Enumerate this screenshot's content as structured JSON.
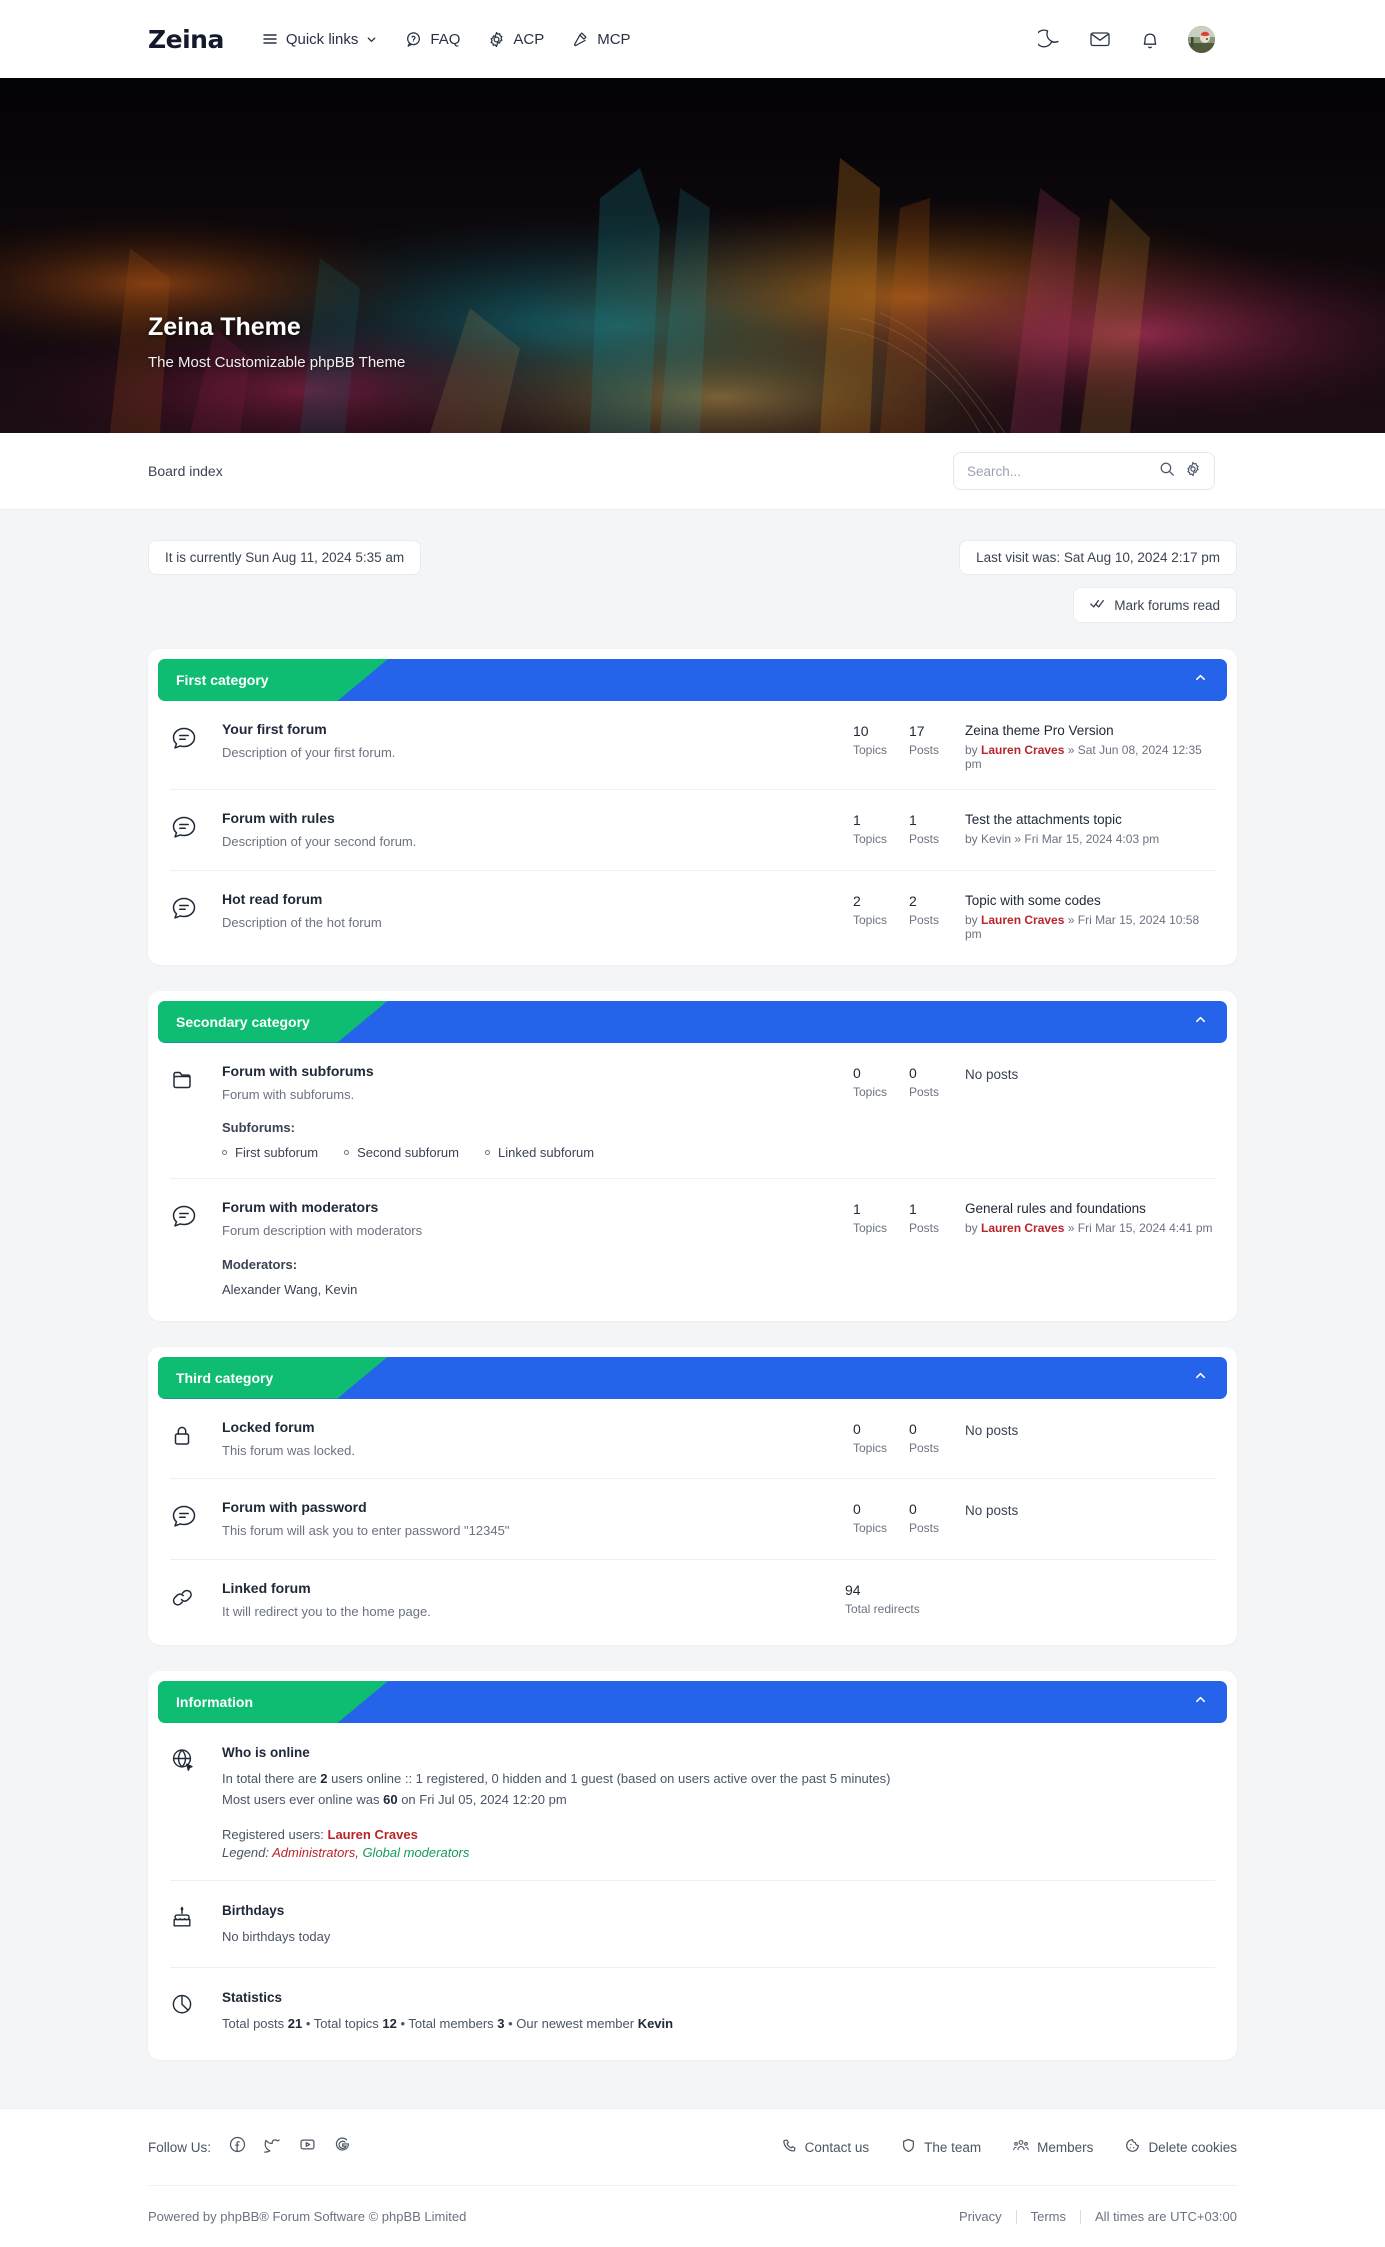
{
  "header": {
    "brand": "Zeina",
    "nav": [
      {
        "label": "Quick links",
        "icon": "hamburger-icon",
        "caret": true
      },
      {
        "label": "FAQ",
        "icon": "question-bubble-icon",
        "caret": false
      },
      {
        "label": "ACP",
        "icon": "gear-icon",
        "caret": false
      },
      {
        "label": "MCP",
        "icon": "gavel-icon",
        "caret": false
      }
    ],
    "icons": [
      "moon-icon",
      "envelope-icon",
      "bell-icon",
      "avatar"
    ]
  },
  "hero": {
    "title": "Zeina Theme",
    "subtitle": "The Most Customizable phpBB Theme"
  },
  "breadcrumb": {
    "label": "Board index"
  },
  "search": {
    "placeholder": "Search...",
    "value": ""
  },
  "status": {
    "current_time": "It is currently Sun Aug 11, 2024 5:35 am",
    "last_visit": "Last visit was: Sat Aug 10, 2024 2:17 pm",
    "mark_read": "Mark forums read"
  },
  "colors": {
    "green": "#0FBD72",
    "blue": "#2563EB",
    "admin": "#B8252A",
    "global_moderator": "#179B56"
  },
  "categories": [
    {
      "title": "First category",
      "forums": [
        {
          "icon": "speech-bubble-icon",
          "name": "Your first forum",
          "desc": "Description of your first forum.",
          "topics": "10",
          "topics_label": "Topics",
          "posts": "17",
          "posts_label": "Posts",
          "last_title": "Zeina theme Pro Version",
          "last_by": "by",
          "last_user": "Lauren Craves",
          "last_date": "» Sat Jun 08, 2024 12:35 pm"
        },
        {
          "icon": "speech-bubble-icon",
          "name": "Forum with rules",
          "desc": "Description of your second forum.",
          "topics": "1",
          "topics_label": "Topics",
          "posts": "1",
          "posts_label": "Posts",
          "last_title": "Test the attachments topic",
          "last_by": "by",
          "last_user": "Kevin",
          "last_date": "» Fri Mar 15, 2024 4:03 pm",
          "user_plain": true
        },
        {
          "icon": "speech-bubble-icon",
          "name": "Hot read forum",
          "desc": "Description of the hot forum",
          "topics": "2",
          "topics_label": "Topics",
          "posts": "2",
          "posts_label": "Posts",
          "last_title": "Topic with some codes",
          "last_by": "by",
          "last_user": "Lauren Craves",
          "last_date": "» Fri Mar 15, 2024 10:58 pm"
        }
      ]
    },
    {
      "title": "Secondary category",
      "forums": [
        {
          "icon": "folder-icon",
          "name": "Forum with subforums",
          "desc": "Forum with subforums.",
          "subforums_label": "Subforums:",
          "subforums": [
            "First subforum",
            "Second subforum",
            "Linked subforum"
          ],
          "topics": "0",
          "topics_label": "Topics",
          "posts": "0",
          "posts_label": "Posts",
          "no_posts": "No posts"
        },
        {
          "icon": "speech-bubble-icon",
          "name": "Forum with moderators",
          "desc": "Forum description with moderators",
          "moderators_label": "Moderators:",
          "moderators": "Alexander Wang, Kevin",
          "topics": "1",
          "topics_label": "Topics",
          "posts": "1",
          "posts_label": "Posts",
          "last_title": "General rules and foundations",
          "last_by": "by",
          "last_user": "Lauren Craves",
          "last_date": "» Fri Mar 15, 2024 4:41 pm"
        }
      ]
    },
    {
      "title": "Third category",
      "forums": [
        {
          "icon": "lock-icon",
          "name": "Locked forum",
          "desc": "This forum was locked.",
          "topics": "0",
          "topics_label": "Topics",
          "posts": "0",
          "posts_label": "Posts",
          "no_posts": "No posts"
        },
        {
          "icon": "speech-bubble-icon",
          "name": "Forum with password",
          "desc": "This forum will ask you to enter password \"12345\"",
          "topics": "0",
          "topics_label": "Topics",
          "posts": "0",
          "posts_label": "Posts",
          "no_posts": "No posts"
        },
        {
          "icon": "link-icon",
          "name": "Linked forum",
          "desc": "It will redirect you to the home page.",
          "redirects": "94",
          "redirects_label": "Total redirects"
        }
      ]
    }
  ],
  "information": {
    "title": "Information",
    "who_is_online": {
      "icon": "globe-icon",
      "title": "Who is online",
      "line1_a": "In total there are ",
      "line1_b": "2",
      "line1_c": " users online :: 1 registered, 0 hidden and 1 guest (based on users active over the past 5 minutes)",
      "line2_a": "Most users ever online was ",
      "line2_b": "60",
      "line2_c": " on Fri Jul 05, 2024 12:20 pm",
      "registered_label": "Registered users: ",
      "registered_user": "Lauren Craves",
      "legend_label": "Legend: ",
      "legend_admins": "Administrators",
      "legend_sep": ", ",
      "legend_gmods": "Global moderators"
    },
    "birthdays": {
      "icon": "cake-icon",
      "title": "Birthdays",
      "text": "No birthdays today"
    },
    "statistics": {
      "icon": "pie-chart-icon",
      "title": "Statistics",
      "t1": "Total posts ",
      "v1": "21",
      "t2": " • Total topics ",
      "v2": "12",
      "t3": " • Total members ",
      "v3": "3",
      "t4": " • Our newest member ",
      "v4": "Kevin"
    }
  },
  "footer": {
    "follow_label": "Follow Us:",
    "socials": [
      "facebook-icon",
      "twitter-icon",
      "youtube-icon",
      "google-icon"
    ],
    "links": [
      {
        "label": "Contact us",
        "icon": "phone-icon"
      },
      {
        "label": "The team",
        "icon": "shield-icon"
      },
      {
        "label": "Members",
        "icon": "people-icon"
      },
      {
        "label": "Delete cookies",
        "icon": "cookie-icon"
      }
    ],
    "powered": "Powered by phpBB® Forum Software © phpBB Limited",
    "privacy": "Privacy",
    "terms": "Terms",
    "timezone": "All times are UTC+03:00"
  }
}
